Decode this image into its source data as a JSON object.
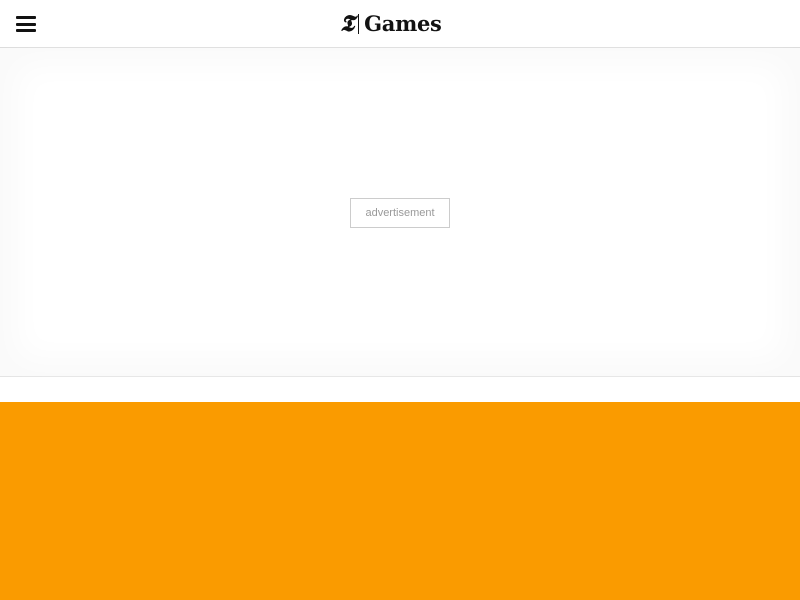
{
  "header": {
    "logo_mark": "𝕿",
    "logo_text": "Games",
    "menu_icon": "hamburger-menu-icon"
  },
  "ad": {
    "label": "advertisement"
  },
  "colors": {
    "accent": "#fa9b00",
    "header_bg": "#ffffff",
    "text": "#121212"
  }
}
